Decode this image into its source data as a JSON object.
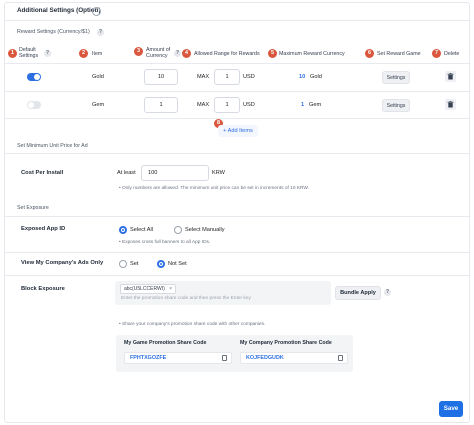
{
  "header": {
    "title": "Additional Settings (Option)",
    "chevron_icon": "chevron-down-icon"
  },
  "reward": {
    "section_label": "Reward Settings (Currency/$1)",
    "help_mark": "?",
    "columns": [
      {
        "num": "1",
        "label": "Default\nSettings"
      },
      {
        "num": "2",
        "label": "Item"
      },
      {
        "num": "3",
        "label": "Amount of\nCurrency"
      },
      {
        "num": "4",
        "label": "Allowed Range for Rewards"
      },
      {
        "num": "5",
        "label": "Maximum Reward Currency"
      },
      {
        "num": "6",
        "label": "Set Reward Game"
      },
      {
        "num": "7",
        "label": "Delete"
      }
    ],
    "rows": [
      {
        "default_on": true,
        "item": "Gold",
        "amount": "10",
        "max_label": "MAX",
        "max_value": "1",
        "unit": "USD",
        "max_reward_num": "10",
        "max_reward_item": "Gold",
        "settings_label": "Settings"
      },
      {
        "default_on": false,
        "item": "Gem",
        "amount": "1",
        "max_label": "MAX",
        "max_value": "1",
        "unit": "USD",
        "max_reward_num": "1",
        "max_reward_item": "Gem",
        "settings_label": "Settings"
      }
    ],
    "add_num": "8",
    "add_label": "+ Add Items"
  },
  "cost": {
    "section_label": "Set Minimum Unit Price for Ad",
    "label": "Cost Per Install",
    "at_least": "At least",
    "value": "100",
    "currency": "KRW",
    "note": "• Only numbers are allowed. The minimum unit price can be set in increments of 10 KRW."
  },
  "exposure": {
    "section_label": "Set Exposure",
    "app_id_label": "Exposed App ID",
    "app_id_options": [
      "Select All",
      "Select Manually"
    ],
    "app_id_selected": "Select All",
    "app_id_note": "• Exposes cross full banners to all App IDs.",
    "own_ads_label": "View My Company's Ads Only",
    "own_ads_options": [
      "Set",
      "Not Set"
    ],
    "own_ads_selected": "Not Set",
    "block_label": "Block Exposure",
    "block_chip": "abc(U5LCCERWI)",
    "block_chip_close": "×",
    "block_placeholder": "Enter the promotion share code and then press the Enter key",
    "bundle_button": "Bundle Apply",
    "share_note": "• Share your company's promotion share code with other companies.",
    "game_code_label": "My Game Promotion Share Code",
    "game_code": "FPHTXGOZFE",
    "company_code_label": "My Company Promotion Share Code",
    "company_code": "KOJFEDGUDK"
  },
  "footer": {
    "save_label": "Save"
  },
  "colors": {
    "accent": "#2b6fe3",
    "step_badge": "#d9573d"
  }
}
